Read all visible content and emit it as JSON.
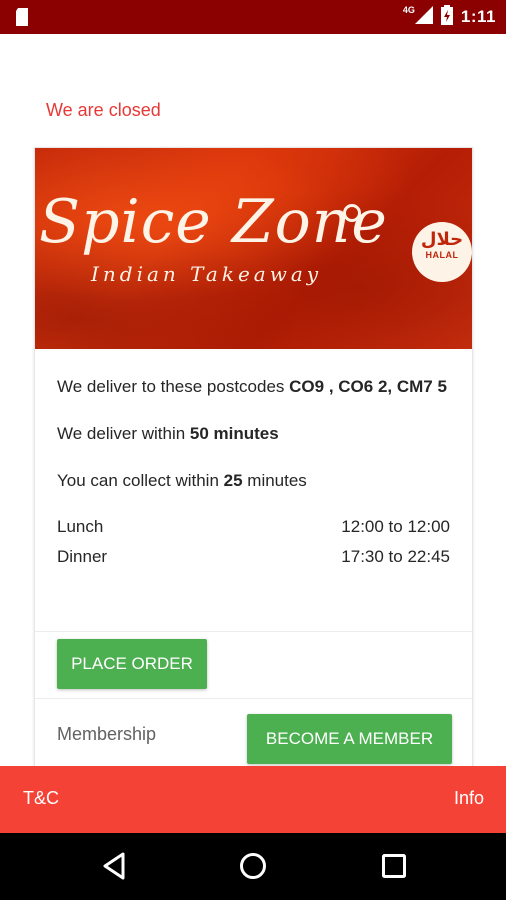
{
  "status_bar": {
    "network": "4G",
    "time": "1:11",
    "icons": [
      "sd-card-icon",
      "signal-icon",
      "battery-charging-icon"
    ]
  },
  "closed_message": "We are closed",
  "restaurant": {
    "name": "Spice Zone",
    "subtitle": "Indian Takeaway",
    "halal_arabic": "حلال",
    "halal_text": "HALAL"
  },
  "delivery": {
    "postcodes_prefix": "We deliver to these postcodes ",
    "postcodes": "CO9 , CO6 2, CM7 5",
    "within_prefix": "We deliver within ",
    "within_value": "50 minutes",
    "collect_prefix": "You can collect within ",
    "collect_value": "25",
    "collect_suffix": " minutes"
  },
  "hours": [
    {
      "label": "Lunch",
      "time": "12:00 to 12:00"
    },
    {
      "label": "Dinner",
      "time": "17:30 to 22:45"
    }
  ],
  "buttons": {
    "place_order": "PLACE ORDER",
    "membership_label": "Membership",
    "become_member": "BECOME A MEMBER"
  },
  "footer": {
    "tc": "T&C",
    "info": "Info"
  },
  "nav": {
    "icons": [
      "back-icon",
      "home-icon",
      "recents-icon"
    ]
  },
  "colors": {
    "status_bar": "#8b0000",
    "closed_text": "#e53935",
    "button_green": "#4caf50",
    "footer_red": "#f44336"
  }
}
